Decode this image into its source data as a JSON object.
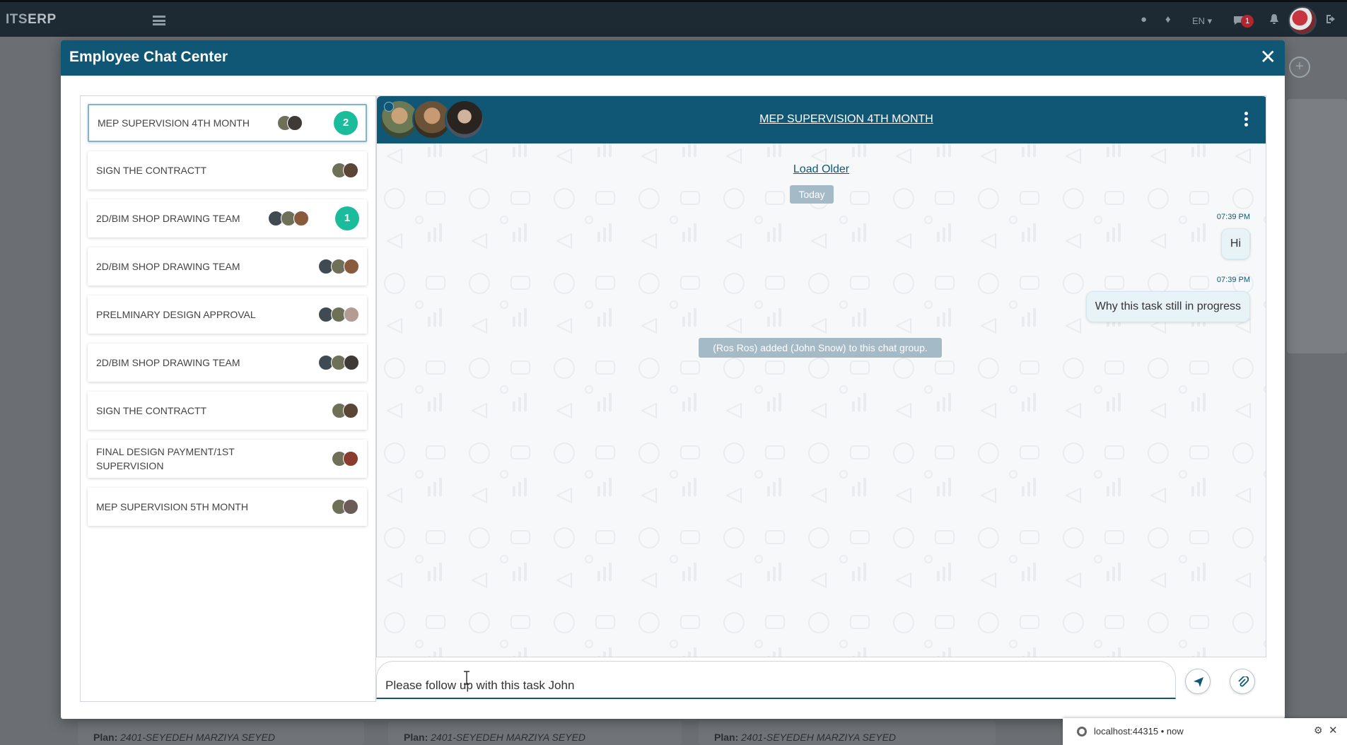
{
  "topbar": {
    "brand_prefix": "ITS",
    "brand_suffix": "ERP",
    "language": "EN ▾",
    "chat_badge": "1"
  },
  "background": {
    "plan_label": "Plan:",
    "plan_value": "2401-SEYEDEH MARZIYA SEYED"
  },
  "modal": {
    "title": "Employee Chat Center",
    "close": "✕"
  },
  "conversations": [
    {
      "name": "MEP SUPERVISION 4TH MONTH",
      "unread": "2",
      "active": true
    },
    {
      "name": "SIGN THE CONTRACTT",
      "unread": ""
    },
    {
      "name": "2D/BIM SHOP DRAWING TEAM",
      "unread": "1"
    },
    {
      "name": "2D/BIM SHOP DRAWING TEAM",
      "unread": ""
    },
    {
      "name": "PRELMINARY DESIGN APPROVAL",
      "unread": ""
    },
    {
      "name": "2D/BIM SHOP DRAWING TEAM",
      "unread": ""
    },
    {
      "name": "SIGN THE CONTRACTT",
      "unread": ""
    },
    {
      "name": "FINAL DESIGN PAYMENT/1ST SUPERVISION",
      "unread": ""
    },
    {
      "name": "MEP SUPERVISION 5TH MONTH",
      "unread": ""
    }
  ],
  "chat": {
    "title": "MEP SUPERVISION 4TH MONTH",
    "load_older": "Load Older",
    "day": "Today",
    "messages": [
      {
        "time": "07:39 PM",
        "text": "Hi"
      },
      {
        "time": "07:39 PM",
        "text": "Why this task still in progress"
      }
    ],
    "system_message": "(Ros Ros) added (John Snow) to this chat group."
  },
  "composer": {
    "value": "Please follow up with this task John"
  },
  "toast": {
    "host": "localhost:44315",
    "separator": "•",
    "time": "now"
  },
  "colors": {
    "primary": "#0f5775",
    "unread": "#1abc9c",
    "navbar": "#1d2a33"
  }
}
